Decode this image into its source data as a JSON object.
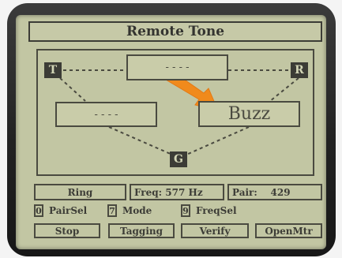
{
  "screen": {
    "title": "Remote Tone"
  },
  "diagram": {
    "nodes": {
      "t": "T",
      "r": "R",
      "g": "G"
    },
    "fields": {
      "top": "- - - -",
      "left": "- - - -",
      "right": "Buzz"
    }
  },
  "status": {
    "mode": "Ring",
    "freq_label": "Freq:",
    "freq_value": "577 Hz",
    "pair_label": "Pair:",
    "pair_value": "429"
  },
  "hotkeys": [
    {
      "key": "0",
      "label": "PairSel"
    },
    {
      "key": "7",
      "label": "Mode"
    },
    {
      "key": "9",
      "label": "FreqSel"
    }
  ],
  "softkeys": [
    "Stop",
    "Tagging",
    "Verify",
    "OpenMtr"
  ],
  "colors": {
    "lcd_background": "#c2c6a3",
    "lcd_ink": "#3c3c36",
    "pointer_arrow": "#f08a1c"
  }
}
